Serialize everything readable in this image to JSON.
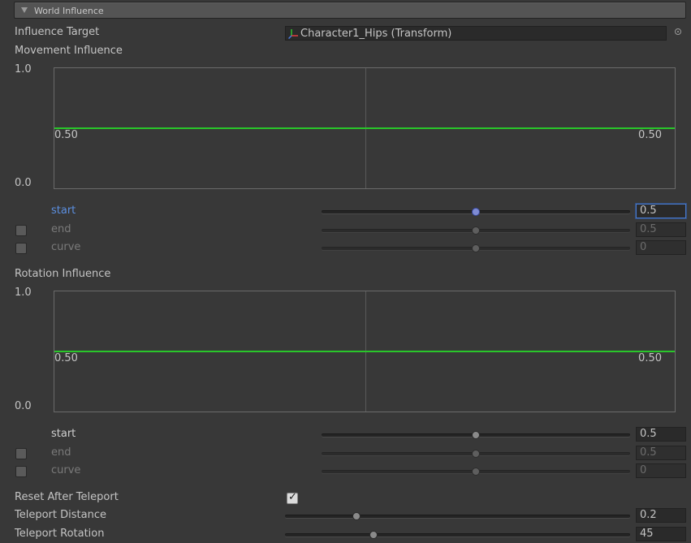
{
  "section": {
    "title": "World Influence",
    "collapse_icon": "triangle-down-icon"
  },
  "influence_target": {
    "label": "Influence Target",
    "value": "Character1_Hips (Transform)",
    "icon": "transform-axes-icon",
    "picker_icon": "object-picker-icon"
  },
  "movement": {
    "label": "Movement Influence",
    "curve": {
      "y_max": "1.0",
      "y_min": "0.0",
      "left_value": "0.50",
      "right_value": "0.50",
      "level": 0.5,
      "line_color": "#29c62a"
    },
    "start": {
      "label": "start",
      "value": "0.5",
      "slider": 0.5
    },
    "end": {
      "label": "end",
      "value": "0.5",
      "slider": 0.5,
      "enabled": false
    },
    "curve_param": {
      "label": "curve",
      "value": "0",
      "slider": 0.5,
      "enabled": false
    }
  },
  "rotation": {
    "label": "Rotation Influence",
    "curve": {
      "y_max": "1.0",
      "y_min": "0.0",
      "left_value": "0.50",
      "right_value": "0.50",
      "level": 0.5,
      "line_color": "#29c62a"
    },
    "start": {
      "label": "start",
      "value": "0.5",
      "slider": 0.5
    },
    "end": {
      "label": "end",
      "value": "0.5",
      "slider": 0.5,
      "enabled": false
    },
    "curve_param": {
      "label": "curve",
      "value": "0",
      "slider": 0.5,
      "enabled": false
    }
  },
  "reset_after_teleport": {
    "label": "Reset After Teleport",
    "checked": true
  },
  "teleport_distance": {
    "label": "Teleport Distance",
    "value": "0.2",
    "slider": 0.2
  },
  "teleport_rotation": {
    "label": "Teleport Rotation",
    "value": "45",
    "slider": 0.25
  }
}
